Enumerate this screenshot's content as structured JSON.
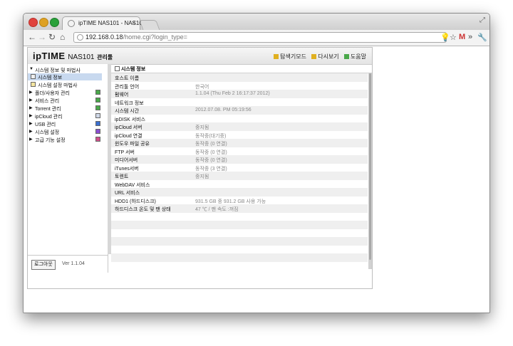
{
  "browser": {
    "tab_title": "ipTIME NAS101 - NAS101",
    "tab_close": "×",
    "url_host": "192.168.0.18",
    "url_path": "/home.cgi?login_type="
  },
  "app": {
    "logo_brand": "ipTIME",
    "logo_model": "NAS101",
    "logo_suffix": "관리툴",
    "header_links": {
      "search_mode": "탐색기모드",
      "refresh": "다시보기",
      "help": "도움말"
    },
    "colors": {
      "accent_nav": "#c8d9ef",
      "badge_green": "#4aa84a",
      "badge_blue": "#3a6fd0",
      "badge_purple": "#8a4fd0",
      "badge_red": "#d04f8a"
    }
  },
  "sidebar": {
    "items": [
      {
        "label": "시스템 정보 및 마법사",
        "arrow": "▼"
      },
      {
        "label": "시스템 정보"
      },
      {
        "label": "시스템 설정 마법사"
      },
      {
        "label": "폴더/사용자 관리",
        "arrow": "▶"
      },
      {
        "label": "서비스 관리",
        "arrow": "▶"
      },
      {
        "label": "Torrent 관리",
        "arrow": "▶"
      },
      {
        "label": "ipCloud 관리",
        "arrow": "▶"
      },
      {
        "label": "USB 관리",
        "arrow": "▶"
      },
      {
        "label": "시스템 설정",
        "arrow": "▶"
      },
      {
        "label": "고급 기능 설정",
        "arrow": "▶"
      }
    ],
    "logout_label": "로그아웃",
    "version": "Ver 1.1.04"
  },
  "content": {
    "section_title": "시스템 정보",
    "rows": [
      {
        "key": "호스트 이름",
        "value": ""
      },
      {
        "key": "관리툴 언어",
        "value": "한국어"
      },
      {
        "key": "펌웨어",
        "value": "1.1.04 (Thu Feb 2 16:17:37 2012)"
      },
      {
        "key": "네트워크 정보",
        "value": ""
      },
      {
        "key": "시스템 시간",
        "value": "2012.07.08. PM 05:19:56"
      },
      {
        "key": "ipDISK 서비스",
        "value": ""
      },
      {
        "key": "ipCloud 서버",
        "value": "중지됨"
      },
      {
        "key": "ipCloud 연결",
        "value": "동작중(대기중)"
      },
      {
        "key": "윈도우 파일 공유",
        "value": "동작중 (0 연결)"
      },
      {
        "key": "FTP 서버",
        "value": "동작중 (0 연결)"
      },
      {
        "key": "미디어서버",
        "value": "동작중 (0 연결)"
      },
      {
        "key": "iTunes서버",
        "value": "동작중 (3 연결)"
      },
      {
        "key": "토렌트",
        "value": "중지됨"
      },
      {
        "key": "WebDAV 서비스",
        "value": ""
      },
      {
        "key": "URL 서비스",
        "value": ""
      },
      {
        "key": "HDD1 (하드디스크)",
        "value": "931.5 GB 중 931.2 GB 사용 가능"
      },
      {
        "key": "하드디스크 온도 및 팬 상태",
        "value": "47 ℃ / 팬 속도 :꺼짐"
      },
      {
        "key": "",
        "value": ""
      },
      {
        "key": "",
        "value": ""
      },
      {
        "key": "",
        "value": ""
      },
      {
        "key": "",
        "value": ""
      },
      {
        "key": "",
        "value": ""
      },
      {
        "key": "",
        "value": ""
      },
      {
        "key": "",
        "value": ""
      }
    ]
  }
}
